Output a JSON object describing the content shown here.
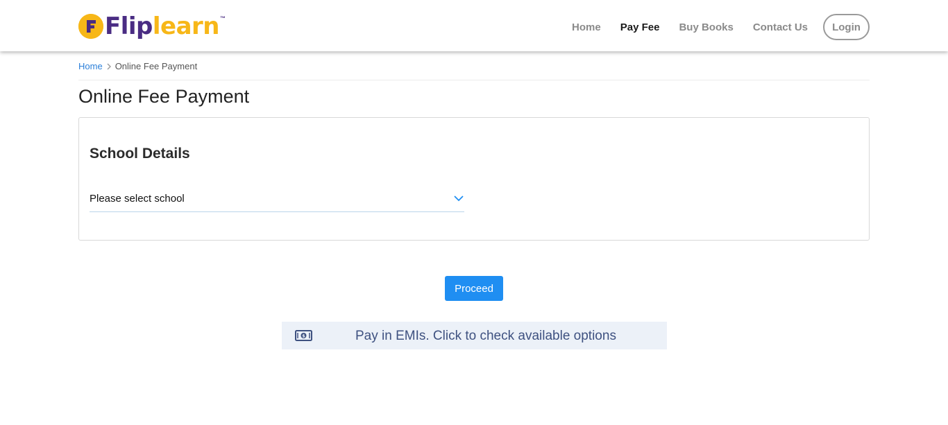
{
  "brand": {
    "part1": "Flip",
    "part2": "learn",
    "tm": "™",
    "badge_letter": "F",
    "colors": {
      "primary": "#4a2c83",
      "accent": "#f7b718"
    }
  },
  "nav": {
    "items": [
      {
        "label": "Home",
        "active": false
      },
      {
        "label": "Pay Fee",
        "active": true
      },
      {
        "label": "Buy Books",
        "active": false
      },
      {
        "label": "Contact Us",
        "active": false
      }
    ],
    "login_label": "Login"
  },
  "breadcrumb": {
    "home": "Home",
    "separator_icon": "chevron-right-icon",
    "current": "Online Fee Payment"
  },
  "page": {
    "title": "Online Fee Payment"
  },
  "school_details": {
    "title": "School Details",
    "select": {
      "value": "Please select school",
      "icon": "chevron-down-icon"
    }
  },
  "actions": {
    "proceed_label": "Proceed",
    "proceed_color": "#1f8ef2"
  },
  "emi": {
    "icon": "cash-icon",
    "label": "Pay in EMIs. Click to check available options"
  }
}
